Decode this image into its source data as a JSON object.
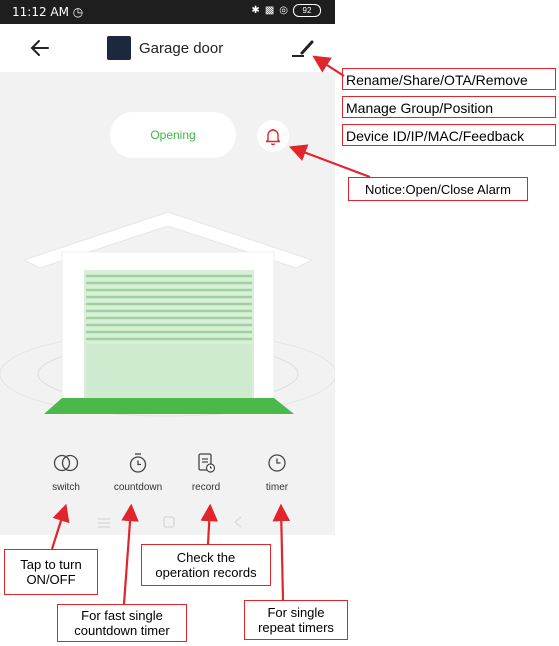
{
  "status_bar": {
    "time": "11:12 AM",
    "battery": "92"
  },
  "header": {
    "title": "Garage door"
  },
  "device": {
    "state": "Opening"
  },
  "controls": [
    {
      "label": "switch"
    },
    {
      "label": "countdown"
    },
    {
      "label": "record"
    },
    {
      "label": "timer"
    }
  ],
  "annotations": {
    "edit_menu": [
      "Rename/Share/OTA/Remove",
      "Manage Group/Position",
      "Device ID/IP/MAC/Feedback"
    ],
    "notice": "Notice:Open/Close Alarm",
    "switch_tip": [
      "Tap to turn",
      "ON/OFF"
    ],
    "record_tip": [
      "Check the",
      "operation records"
    ],
    "countdown_tip": [
      "For fast single",
      "countdown timer"
    ],
    "timer_tip": [
      "For single",
      "repeat timers"
    ]
  },
  "colors": {
    "accent_green": "#3cb84a",
    "alert_red": "#e0262c",
    "panel_gray": "#f2f2f2",
    "status_bar": "#1e1e1e"
  },
  "icons": {
    "back": "arrow-left-icon",
    "edit": "pencil-icon",
    "notice": "bell-icon",
    "switch": "toggle-circles-icon",
    "countdown": "stopwatch-icon",
    "record": "document-clock-icon",
    "timer": "clock-icon"
  }
}
